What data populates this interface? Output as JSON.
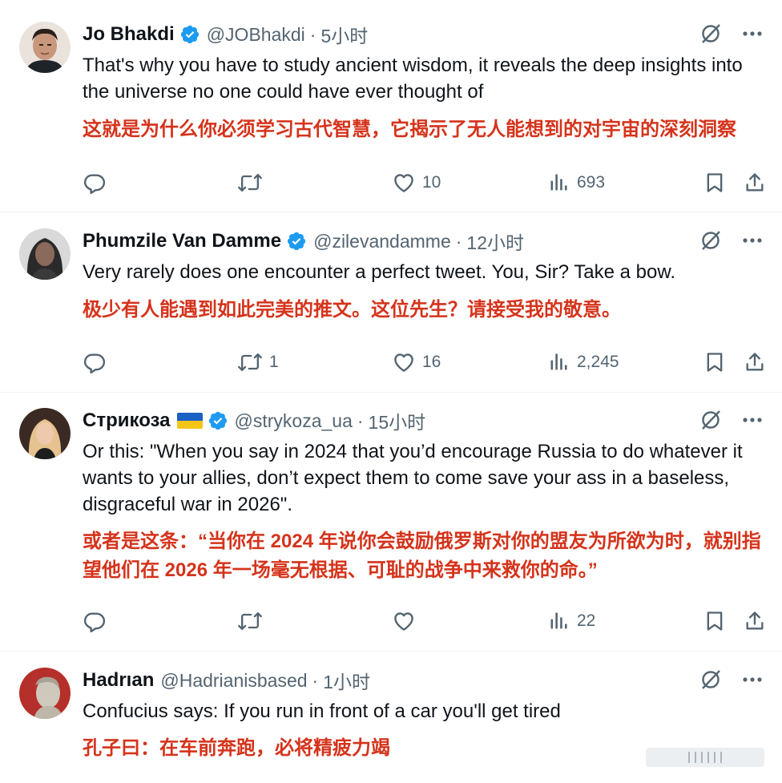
{
  "posts": [
    {
      "name": "Jo Bhakdi",
      "verified": true,
      "flag": false,
      "handle": "@JOBhakdi",
      "time": "5小时",
      "text": "That's why you have to study ancient wisdom, it reveals the deep insights into the universe no one could have ever thought of",
      "translation": "这就是为什么你必须学习古代智慧，它揭示了无人能想到的对宇宙的深刻洞察",
      "replies": "",
      "reposts": "",
      "likes": "10",
      "views": "693"
    },
    {
      "name": "Phumzile Van Damme",
      "verified": true,
      "flag": false,
      "handle": "@zilevandamme",
      "time": "12小时",
      "text": "Very rarely does one encounter a perfect tweet. You, Sir? Take a bow.",
      "translation": "极少有人能遇到如此完美的推文。这位先生？请接受我的敬意。",
      "replies": "",
      "reposts": "1",
      "likes": "16",
      "views": "2,245"
    },
    {
      "name": "Стрикоза",
      "verified": true,
      "flag": true,
      "handle": "@strykoza_ua",
      "time": "15小时",
      "text": "Or this: \"When you say in 2024 that you’d encourage Russia to do whatever it wants to your allies, don’t expect them to come save your ass in a baseless, disgraceful war in 2026\".",
      "translation": "或者是这条：“当你在 2024 年说你会鼓励俄罗斯对你的盟友为所欲为时，就别指望他们在 2026 年一场毫无根据、可耻的战争中来救你的命。”",
      "replies": "",
      "reposts": "",
      "likes": "",
      "views": "22"
    },
    {
      "name": "Hadrıan",
      "verified": false,
      "flag": false,
      "handle": "@Hadrianisbased",
      "time": "1小时",
      "text": "Confucius says: If you run in front of a car you'll get tired",
      "translation": "孔子曰：在车前奔跑，必将精疲力竭"
    }
  ],
  "separator": "·",
  "icons": {
    "verified": "verified-badge-icon",
    "grok": "grok-icon",
    "more": "more-options-icon",
    "reply": "reply-icon",
    "repost": "repost-icon",
    "like": "like-icon",
    "views": "views-icon",
    "bookmark": "bookmark-icon",
    "share": "share-icon"
  },
  "colors": {
    "translation": "#d5331b",
    "verified": "#1d9bf0",
    "secondary_text": "#536471"
  }
}
